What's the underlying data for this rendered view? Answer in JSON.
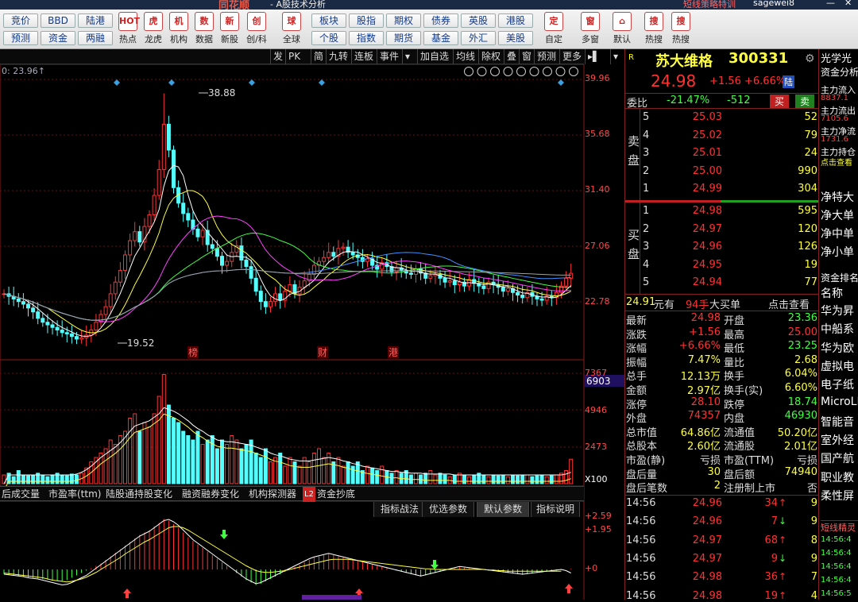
{
  "titlebar": {
    "logo": "同花顺",
    "subtitle": "- A股技术分析",
    "strategy": "短线策略特训",
    "user": "sagewei8"
  },
  "toolbar": {
    "btns_row1": [
      "竞价",
      "BBD",
      "陆港"
    ],
    "btns_row2": [
      "预测",
      "资金",
      "两融"
    ],
    "icons": [
      {
        "label": "热点",
        "glyph": "HOT"
      },
      {
        "label": "龙虎",
        "glyph": "虎"
      },
      {
        "label": "机构",
        "glyph": "机"
      },
      {
        "label": "数据",
        "glyph": "数"
      },
      {
        "label": "新股",
        "glyph": "新"
      },
      {
        "label": "创/科",
        "glyph": "创"
      },
      {
        "label": "全球",
        "glyph": "球"
      }
    ],
    "btns_mid_row1": [
      "板块",
      "股指",
      "期权",
      "债券",
      "英股",
      "港股"
    ],
    "btns_mid_row2": [
      "个股",
      "指数",
      "期货",
      "基金",
      "外汇",
      "美股"
    ],
    "icons_right": [
      {
        "label": "自定",
        "glyph": "定"
      },
      {
        "label": "多窗",
        "glyph": "窗"
      },
      {
        "label": "默认",
        "glyph": "⌂"
      },
      {
        "label": "热搜",
        "glyph": "搜"
      },
      {
        "label": "热搜",
        "glyph": "搜"
      }
    ]
  },
  "chart_menu": [
    "发",
    "PK",
    "简",
    "九转",
    "连板",
    "事件",
    "▾",
    "加自选",
    "均线",
    "除权",
    "叠",
    "窗",
    "预测",
    "更多",
    "▸▌",
    "▾"
  ],
  "chart_info": {
    "ma_readout": "0: 23.96↑",
    "tags": [
      "榜",
      "财",
      "港"
    ]
  },
  "chart_data": [
    {
      "type": "candlestick",
      "title": "",
      "ylim": [
        19.52,
        39.96
      ],
      "yticks": [
        39.96,
        35.68,
        31.4,
        27.06,
        22.78
      ],
      "high_label": "38.88",
      "low_label": "19.52",
      "yaxis_max_label": "39.96"
    },
    {
      "type": "bar",
      "name": "volume",
      "yticks": [
        "7367",
        "4946",
        "2473"
      ],
      "current": "6903",
      "unit": "X100"
    },
    {
      "type": "line",
      "name": "indicator",
      "yticks": [
        "+2.59",
        "+1.95",
        "+0"
      ]
    }
  ],
  "bottom_tabs": [
    "后成交量",
    "市盈率(ttm)",
    "陆股通持股变化",
    "融资融券变化",
    "机构探测器",
    "L2",
    "资金抄底"
  ],
  "indicator_tabs": [
    "指标战法",
    "优选参数",
    "默认参数",
    "指标说明"
  ],
  "stock": {
    "code_flag": "R",
    "name": "苏大维格",
    "code": "300331",
    "price": "24.98",
    "change": "+1.56",
    "pct": "+6.66%",
    "market": "陆",
    "weibi_label": "委比",
    "weibi": "-21.47%",
    "weicha": "-512",
    "buy_btn": "买",
    "sell_btn": "卖",
    "sell_label": "卖盘",
    "buy_label": "买盘",
    "asks": [
      [
        "5",
        "25.03",
        "52"
      ],
      [
        "4",
        "25.02",
        "79"
      ],
      [
        "3",
        "25.01",
        "24"
      ],
      [
        "2",
        "25.00",
        "990"
      ],
      [
        "1",
        "24.99",
        "304"
      ]
    ],
    "bids": [
      [
        "1",
        "24.98",
        "595"
      ],
      [
        "2",
        "24.97",
        "120"
      ],
      [
        "3",
        "24.96",
        "126"
      ],
      [
        "4",
        "24.95",
        "19"
      ],
      [
        "5",
        "24.94",
        "77"
      ]
    ],
    "bigorder": {
      "price": "24.91",
      "unit": "元有",
      "vol": "94手",
      "type": "大买单",
      "link": "点击查看"
    },
    "stats": [
      [
        "最新",
        "24.98",
        "开盘",
        "23.36"
      ],
      [
        "涨跌",
        "+1.56",
        "最高",
        "25.00"
      ],
      [
        "涨幅",
        "+6.66%",
        "最低",
        "23.25"
      ],
      [
        "振幅",
        "7.47%",
        "量比",
        "2.68"
      ],
      [
        "总手",
        "12.13万",
        "换手",
        "6.04%"
      ],
      [
        "金额",
        "2.97亿",
        "换手(实)",
        "6.60%"
      ],
      [
        "涨停",
        "28.10",
        "跌停",
        "18.74"
      ],
      [
        "外盘",
        "74357",
        "内盘",
        "46930"
      ],
      [
        "总市值",
        "64.86亿",
        "流通值",
        "50.20亿"
      ],
      [
        "总股本",
        "2.60亿",
        "流通股",
        "2.01亿"
      ],
      [
        "市盈(静)",
        "亏损",
        "市盈(TTM)",
        "亏损"
      ],
      [
        "盘后量",
        "30",
        "盘后额",
        "74940"
      ],
      [
        "盘后笔数",
        "2",
        "注册制上市",
        "否"
      ]
    ],
    "ticks": [
      [
        "14:56",
        "24.96",
        "34",
        "9"
      ],
      [
        "14:56",
        "24.96",
        "7",
        "9"
      ],
      [
        "14:56",
        "24.97",
        "68",
        "8"
      ],
      [
        "14:56",
        "24.97",
        "9",
        "9"
      ],
      [
        "14:56",
        "24.98",
        "36",
        "7"
      ],
      [
        "14:56",
        "24.98",
        "19",
        "4"
      ]
    ]
  },
  "right_panel": {
    "title": "光学光",
    "subtitle": "资金分析",
    "items": [
      "主力流入",
      "8837.1",
      "主力流出",
      "7105.6",
      "主力净流",
      "1731.6",
      "主力持仓",
      "点击查看"
    ],
    "net": [
      "净特大",
      "净大单",
      "净中单",
      "净小单"
    ],
    "rank_title": "资金排名",
    "rank_head": "名称",
    "rank": [
      "华为昇",
      "中船系",
      "华为欧",
      "虚拟电",
      "电子纸",
      "MicroLE",
      "智能音",
      "室外经",
      "国产航",
      "职业教",
      "柔性屏"
    ],
    "strat_title": "短线精灵",
    "strat_times": [
      "14:56:4",
      "14:56:4",
      "14:56:4",
      "14:56:4",
      "14:56:5"
    ]
  }
}
